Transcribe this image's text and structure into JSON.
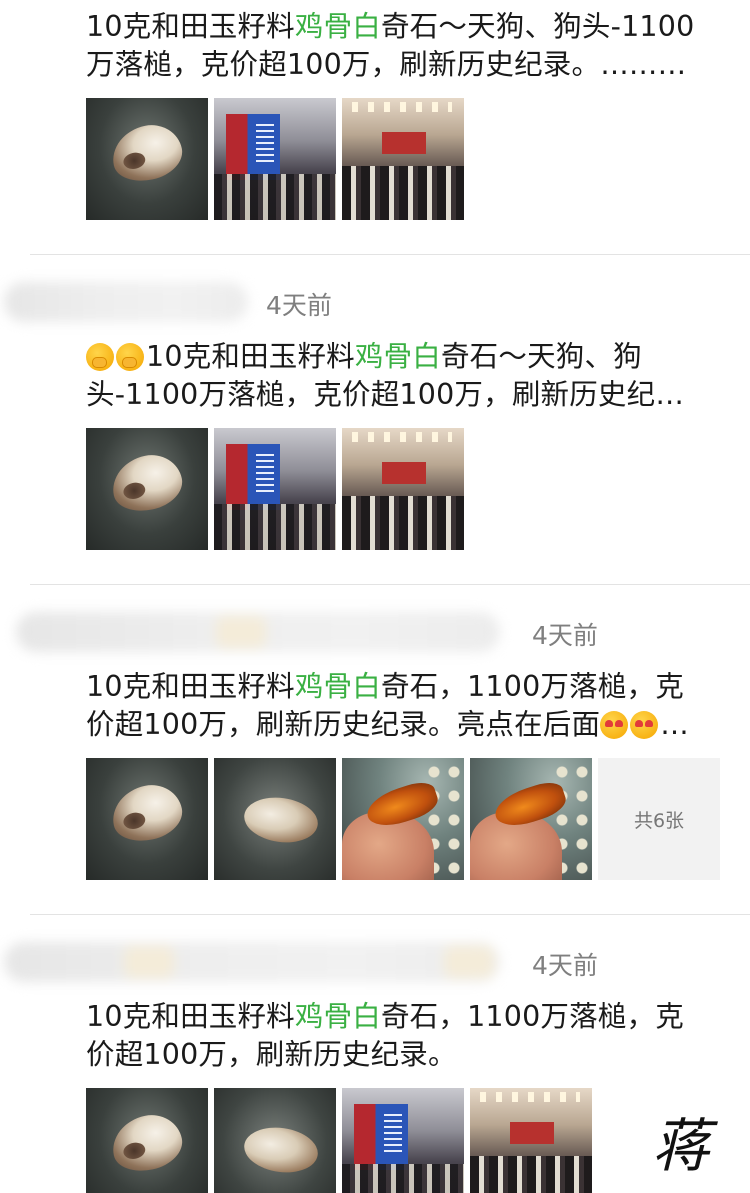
{
  "posts": [
    {
      "time": "",
      "text_lines": [
        {
          "before": "10克和田玉籽料",
          "highlight": "鸡骨白",
          "after": "奇石～天狗、狗头-1100"
        },
        {
          "before": "万落槌，克价超100万，刷新历史纪录。………",
          "highlight": "",
          "after": ""
        }
      ],
      "more_label": ""
    },
    {
      "time": "4天前",
      "text_lines": [
        {
          "before": "10克和田玉籽料",
          "highlight": "鸡骨白",
          "after": "奇石～天狗、狗"
        },
        {
          "before": "头-1100万落槌，克价超100万，刷新历史纪…",
          "highlight": "",
          "after": ""
        }
      ],
      "more_label": ""
    },
    {
      "time": "4天前",
      "text_lines": [
        {
          "before": "10克和田玉籽料",
          "highlight": "鸡骨白",
          "after": "奇石，1100万落槌，克"
        },
        {
          "before": "价超100万，刷新历史纪录。亮点在后面",
          "highlight": "",
          "after": "…"
        }
      ],
      "more_label": "共6张"
    },
    {
      "time": "4天前",
      "text_lines": [
        {
          "before": "10克和田玉籽料",
          "highlight": "鸡骨白",
          "after": "奇石，1100万落槌，克"
        },
        {
          "before": "价超100万，刷新历史纪录。",
          "highlight": "",
          "after": ""
        }
      ],
      "more_label": ""
    }
  ],
  "signature": "蒋",
  "colors": {
    "highlight": "#3ab043",
    "time": "#7f7f7f",
    "divider": "#e3e3e3"
  }
}
